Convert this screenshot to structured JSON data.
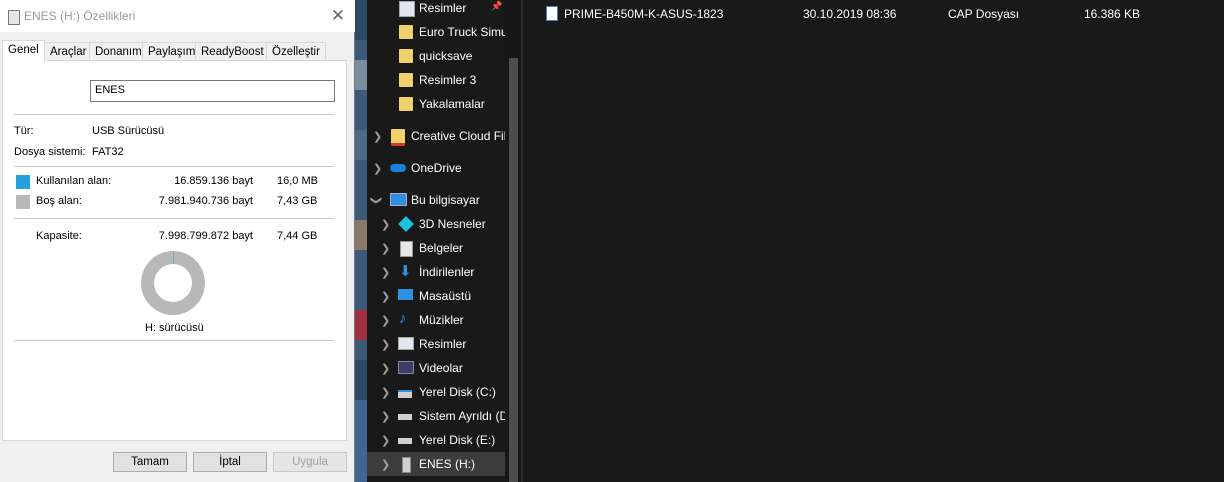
{
  "dialog": {
    "title": "ENES (H:) Özellikleri",
    "close_glyph": "✕",
    "tabs": [
      "Genel",
      "Araçlar",
      "Donanım",
      "Paylaşım",
      "ReadyBoost",
      "Özelleştir"
    ],
    "volume_name": "ENES",
    "type_label": "Tür:",
    "type_value": "USB Sürücüsü",
    "fs_label": "Dosya sistemi:",
    "fs_value": "FAT32",
    "used_label": "Kullanılan alan:",
    "used_bytes": "16.859.136 bayt",
    "used_size": "16,0 MB",
    "free_label": "Boş alan:",
    "free_bytes": "7.981.940.736 bayt",
    "free_size": "7,43 GB",
    "capacity_label": "Kapasite:",
    "capacity_bytes": "7.998.799.872 bayt",
    "capacity_size": "7,44 GB",
    "used_fraction": 0.0021,
    "drive_label": "H: sürücüsü",
    "buttons": {
      "ok": "Tamam",
      "cancel": "İptal",
      "apply": "Uygula"
    },
    "colors": {
      "used": "#26a0da",
      "free": "#b8b8b8"
    }
  },
  "nav": {
    "items": [
      {
        "label": "Resimler",
        "icon": "pictures-icon",
        "pinned": true
      },
      {
        "label": "Euro Truck Simu",
        "icon": "folder-icon"
      },
      {
        "label": "quicksave",
        "icon": "folder-icon"
      },
      {
        "label": "Resimler 3",
        "icon": "folder-icon"
      },
      {
        "label": "Yakalamalar",
        "icon": "folder-icon"
      },
      {
        "label": "Creative Cloud Fil",
        "icon": "creative-cloud-icon"
      },
      {
        "label": "OneDrive",
        "icon": "onedrive-icon"
      },
      {
        "label": "Bu bilgisayar",
        "icon": "computer-icon"
      },
      {
        "label": "3D Nesneler",
        "icon": "3d-objects-icon"
      },
      {
        "label": "Belgeler",
        "icon": "documents-icon"
      },
      {
        "label": "İndirilenler",
        "icon": "downloads-icon"
      },
      {
        "label": "Masaüstü",
        "icon": "desktop-icon"
      },
      {
        "label": "Müzikler",
        "icon": "music-icon"
      },
      {
        "label": "Resimler",
        "icon": "pictures-icon"
      },
      {
        "label": "Videolar",
        "icon": "videos-icon"
      },
      {
        "label": "Yerel Disk (C:)",
        "icon": "drive-icon"
      },
      {
        "label": "Sistem Ayrıldı (D",
        "icon": "drive-icon"
      },
      {
        "label": "Yerel Disk (E:)",
        "icon": "drive-icon"
      },
      {
        "label": "ENES (H:)",
        "icon": "usb-drive-icon",
        "selected": true
      }
    ],
    "pin_glyph": "📌"
  },
  "files": [
    {
      "name": "PRIME-B450M-K-ASUS-1823",
      "date": "30.10.2019 08:36",
      "type": "CAP Dosyası",
      "size": "16.386 KB"
    }
  ]
}
